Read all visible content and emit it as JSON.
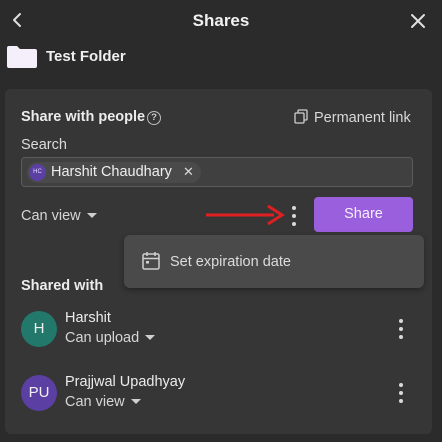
{
  "header": {
    "title": "Shares"
  },
  "folder": {
    "name": "Test Folder"
  },
  "share_with_people": {
    "label": "Share with people",
    "help_glyph": "?",
    "permanent_link_label": "Permanent link",
    "search_label": "Search",
    "chip": {
      "initials": "HC",
      "name": "Harshit Chaudhary",
      "remove_glyph": "✕"
    },
    "permission": "Can view",
    "share_button": "Share"
  },
  "menu": {
    "items": [
      {
        "label": "Set expiration date",
        "icon": "calendar-icon"
      }
    ]
  },
  "shared_with": {
    "label": "Shared with",
    "people": [
      {
        "initials": "H",
        "name": "Harshit",
        "permission": "Can upload",
        "avatar_color": "#21786b"
      },
      {
        "initials": "PU",
        "name": "Prajjwal Upadhyay",
        "permission": "Can view",
        "avatar_color": "#5b3fa3"
      }
    ]
  },
  "colors": {
    "accent": "#9a5fdc",
    "annotation_arrow": "#e02020",
    "background": "#2b2b2b",
    "panel": "#363636"
  }
}
